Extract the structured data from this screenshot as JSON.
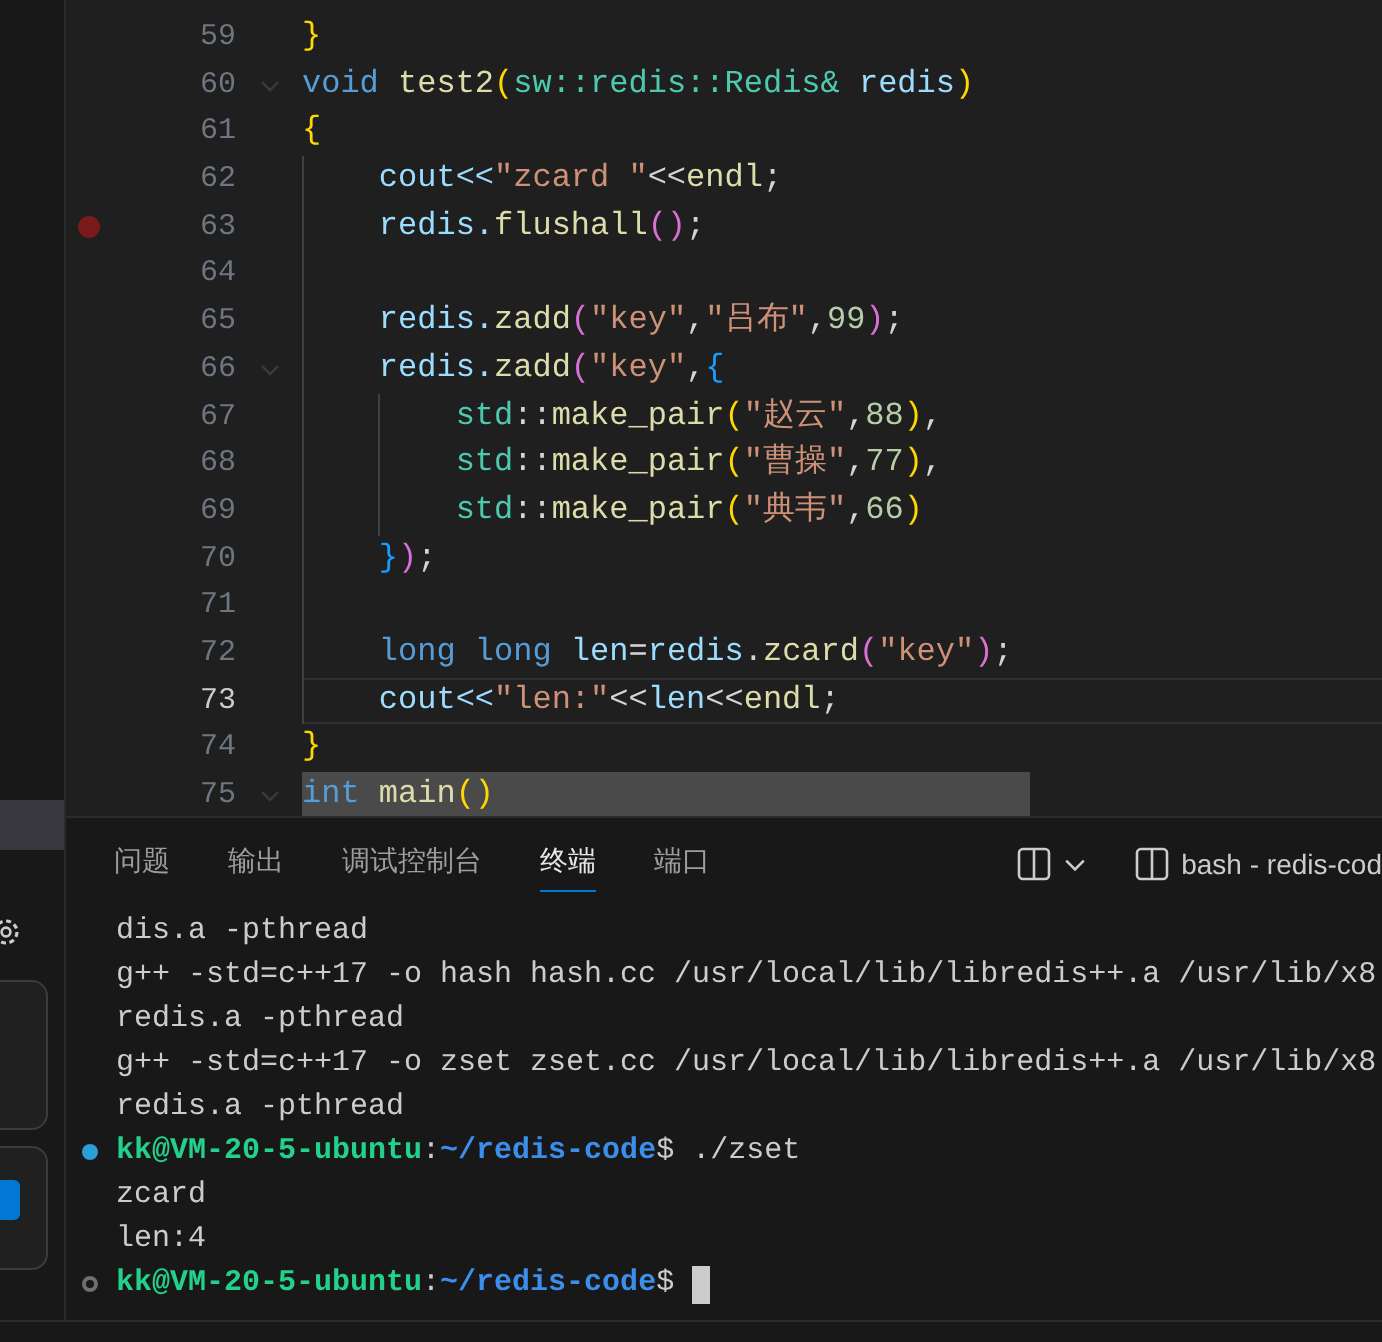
{
  "editor": {
    "lines": [
      {
        "number": "59",
        "tokens": [
          {
            "t": "}",
            "kind": "b1"
          }
        ]
      },
      {
        "number": "60",
        "fold": true,
        "tokens": [
          {
            "t": "void ",
            "kind": "kw"
          },
          {
            "t": "test2",
            "kind": "fn"
          },
          {
            "t": "(",
            "kind": "b1"
          },
          {
            "t": "sw::redis::Redis& ",
            "kind": "type"
          },
          {
            "t": "redis",
            "kind": "var"
          },
          {
            "t": ")",
            "kind": "b1"
          }
        ]
      },
      {
        "number": "61",
        "tokens": [
          {
            "t": "{",
            "kind": "b1"
          }
        ]
      },
      {
        "number": "62",
        "tokens": [
          {
            "t": "    cout<<",
            "kind": "var"
          },
          {
            "t": "\"zcard \"",
            "kind": "str"
          },
          {
            "t": "<<",
            "kind": "p"
          },
          {
            "t": "endl",
            "kind": "fn"
          },
          {
            "t": ";",
            "kind": "p"
          }
        ]
      },
      {
        "number": "63",
        "breakpoint": true,
        "tokens": [
          {
            "t": "    redis.",
            "kind": "var"
          },
          {
            "t": "flushall",
            "kind": "fn"
          },
          {
            "t": "()",
            "kind": "b2"
          },
          {
            "t": ";",
            "kind": "p"
          }
        ]
      },
      {
        "number": "64"
      },
      {
        "number": "65",
        "tokens": [
          {
            "t": "    redis.",
            "kind": "var"
          },
          {
            "t": "zadd",
            "kind": "fn"
          },
          {
            "t": "(",
            "kind": "b2"
          },
          {
            "t": "\"key\"",
            "kind": "str"
          },
          {
            "t": ",",
            "kind": "p"
          },
          {
            "t": "\"吕布\"",
            "kind": "str"
          },
          {
            "t": ",",
            "kind": "p"
          },
          {
            "t": "99",
            "kind": "num"
          },
          {
            "t": ")",
            "kind": "b2"
          },
          {
            "t": ";",
            "kind": "p"
          }
        ]
      },
      {
        "number": "66",
        "fold": true,
        "tokens": [
          {
            "t": "    redis.",
            "kind": "var"
          },
          {
            "t": "zadd",
            "kind": "fn"
          },
          {
            "t": "(",
            "kind": "b2"
          },
          {
            "t": "\"key\"",
            "kind": "str"
          },
          {
            "t": ",",
            "kind": "p"
          },
          {
            "t": "{",
            "kind": "b3"
          }
        ]
      },
      {
        "number": "67",
        "tokens": [
          {
            "t": "        std",
            "kind": "type"
          },
          {
            "t": "::",
            "kind": "p"
          },
          {
            "t": "make_pair",
            "kind": "fn"
          },
          {
            "t": "(",
            "kind": "b1"
          },
          {
            "t": "\"赵云\"",
            "kind": "str"
          },
          {
            "t": ",",
            "kind": "p"
          },
          {
            "t": "88",
            "kind": "num"
          },
          {
            "t": ")",
            "kind": "b1"
          },
          {
            "t": ",",
            "kind": "p"
          }
        ]
      },
      {
        "number": "68",
        "tokens": [
          {
            "t": "        std",
            "kind": "type"
          },
          {
            "t": "::",
            "kind": "p"
          },
          {
            "t": "make_pair",
            "kind": "fn"
          },
          {
            "t": "(",
            "kind": "b1"
          },
          {
            "t": "\"曹操\"",
            "kind": "str"
          },
          {
            "t": ",",
            "kind": "p"
          },
          {
            "t": "77",
            "kind": "num"
          },
          {
            "t": ")",
            "kind": "b1"
          },
          {
            "t": ",",
            "kind": "p"
          }
        ]
      },
      {
        "number": "69",
        "tokens": [
          {
            "t": "        std",
            "kind": "type"
          },
          {
            "t": "::",
            "kind": "p"
          },
          {
            "t": "make_pair",
            "kind": "fn"
          },
          {
            "t": "(",
            "kind": "b1"
          },
          {
            "t": "\"典韦\"",
            "kind": "str"
          },
          {
            "t": ",",
            "kind": "p"
          },
          {
            "t": "66",
            "kind": "num"
          },
          {
            "t": ")",
            "kind": "b1"
          }
        ]
      },
      {
        "number": "70",
        "tokens": [
          {
            "t": "    }",
            "kind": "b3"
          },
          {
            "t": ")",
            "kind": "b2"
          },
          {
            "t": ";",
            "kind": "p"
          }
        ]
      },
      {
        "number": "71"
      },
      {
        "number": "72",
        "tokens": [
          {
            "t": "    long long ",
            "kind": "kw"
          },
          {
            "t": "len",
            "kind": "var"
          },
          {
            "t": "=",
            "kind": "p"
          },
          {
            "t": "redis",
            "kind": "var"
          },
          {
            "t": ".",
            "kind": "p"
          },
          {
            "t": "zcard",
            "kind": "fn"
          },
          {
            "t": "(",
            "kind": "b2"
          },
          {
            "t": "\"key\"",
            "kind": "str"
          },
          {
            "t": ")",
            "kind": "b2"
          },
          {
            "t": ";",
            "kind": "p"
          }
        ]
      },
      {
        "number": "73",
        "current": true,
        "tokens": [
          {
            "t": "    cout<<",
            "kind": "var"
          },
          {
            "t": "\"len:\"",
            "kind": "str"
          },
          {
            "t": "<<",
            "kind": "p"
          },
          {
            "t": "len",
            "kind": "var"
          },
          {
            "t": "<<",
            "kind": "p"
          },
          {
            "t": "endl",
            "kind": "fn"
          },
          {
            "t": ";",
            "kind": "p"
          }
        ]
      },
      {
        "number": "74",
        "tokens": [
          {
            "t": "}",
            "kind": "b1"
          }
        ]
      },
      {
        "number": "75",
        "fold": true,
        "selected": true,
        "tokens": [
          {
            "t": "int ",
            "kind": "kw"
          },
          {
            "t": "main",
            "kind": "fn"
          },
          {
            "t": "()",
            "kind": "b1"
          }
        ]
      }
    ]
  },
  "panel": {
    "tabs": [
      {
        "label": "问题",
        "selected": false
      },
      {
        "label": "输出",
        "selected": false
      },
      {
        "label": "调试控制台",
        "selected": false
      },
      {
        "label": "终端",
        "selected": true
      },
      {
        "label": "端口",
        "selected": false
      }
    ],
    "terminal_name": "bash - redis-cod",
    "terminal": [
      {
        "kind": "output",
        "text": "dis.a -pthread"
      },
      {
        "kind": "output",
        "text": "g++ -std=c++17 -o hash hash.cc /usr/local/lib/libredis++.a /usr/lib/x8"
      },
      {
        "kind": "output",
        "text": "redis.a -pthread"
      },
      {
        "kind": "output",
        "text": "g++ -std=c++17 -o zset zset.cc /usr/local/lib/libredis++.a /usr/lib/x8"
      },
      {
        "kind": "output",
        "text": "redis.a -pthread"
      },
      {
        "kind": "prompt",
        "finished": true,
        "user": "kk@VM-20-5-ubuntu",
        "sep": ":",
        "path": "~/redis-code",
        "command": "$ ./zset",
        "cursor": false
      },
      {
        "kind": "output",
        "text": "zcard"
      },
      {
        "kind": "output",
        "text": "len:4"
      },
      {
        "kind": "prompt",
        "finished": false,
        "user": "kk@VM-20-5-ubuntu",
        "sep": ":",
        "path": "~/redis-code",
        "command": "$",
        "cursor": true
      }
    ]
  }
}
